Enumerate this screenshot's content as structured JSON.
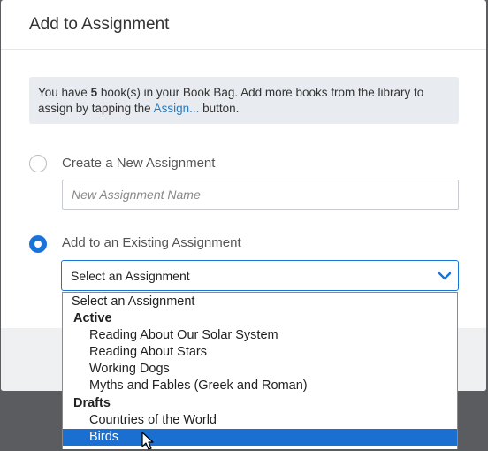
{
  "dialog": {
    "title": "Add to Assignment"
  },
  "info": {
    "prefix": "You have ",
    "count": "5",
    "middle": " book(s) in your Book Bag. Add more books from the library to assign by tapping the ",
    "link": "Assign...",
    "suffix": " button."
  },
  "new_assignment": {
    "label": "Create a New Assignment",
    "placeholder": "New Assignment Name",
    "value": "",
    "selected": false
  },
  "existing_assignment": {
    "label": "Add to an Existing Assignment",
    "selected": true
  },
  "select": {
    "value": "Select an Assignment",
    "options": {
      "placeholder": "Select an Assignment",
      "active_label": "Active",
      "active": [
        "Reading About Our Solar System",
        "Reading About Stars",
        "Working Dogs",
        "Myths and Fables (Greek and Roman)"
      ],
      "drafts_label": "Drafts",
      "drafts": [
        "Countries of the World",
        "Birds"
      ],
      "highlighted": "Birds"
    }
  },
  "colors": {
    "accent": "#1a73d9",
    "highlight": "#1a6fd1",
    "info_bg": "#e8ebef",
    "link": "#2a7bbd",
    "overlay": "#5a5c60"
  },
  "icons": {
    "select_chevron": "chevron-down-icon",
    "cursor": "mouse-pointer-icon"
  }
}
